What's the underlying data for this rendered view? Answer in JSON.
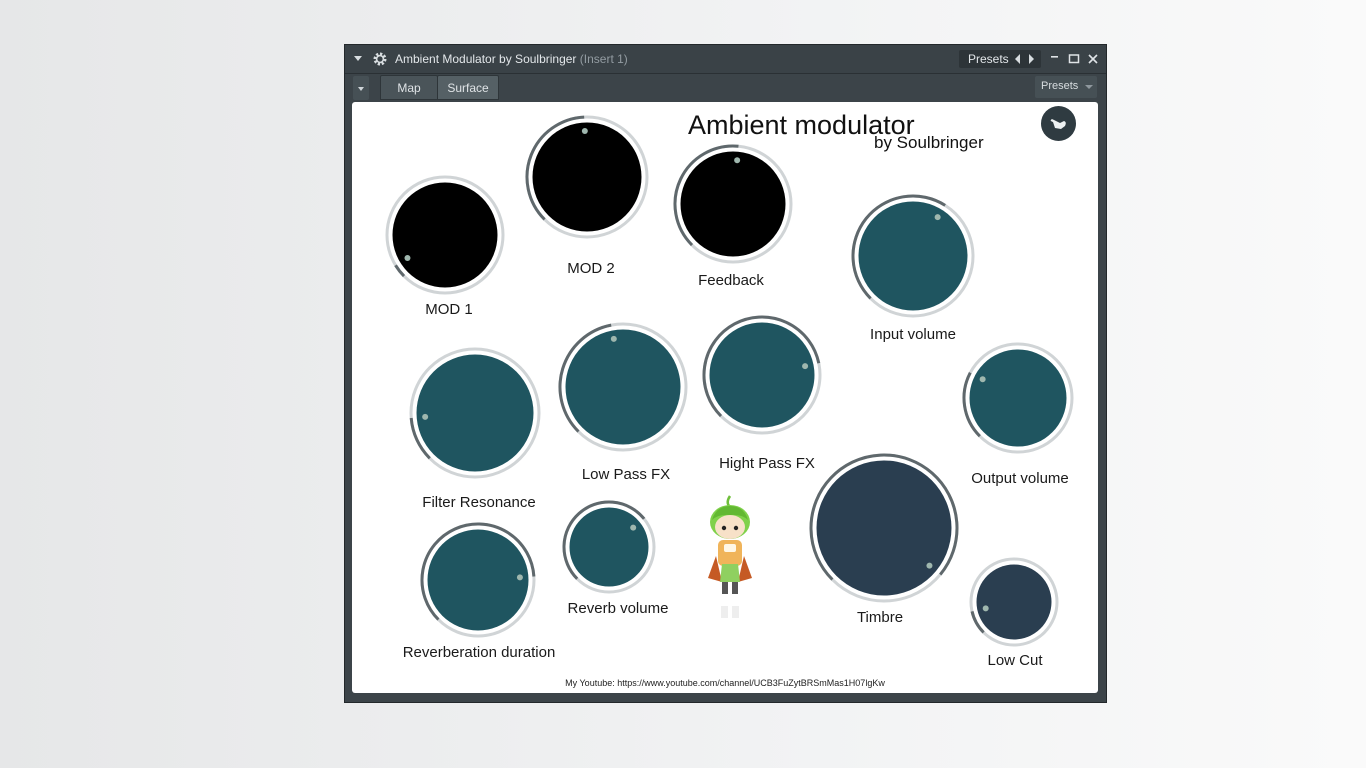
{
  "window": {
    "title": "Ambient Modulator by Soulbringer",
    "title_sub": "(Insert 1)",
    "presets_label": "Presets"
  },
  "toolbar": {
    "tabs": [
      {
        "label": "Map"
      },
      {
        "label": "Surface"
      }
    ],
    "presets_label": "Presets"
  },
  "plugin": {
    "title": "Ambient modulator",
    "subtitle": "by Soulbringer",
    "footer": "My Youtube: https://www.youtube.com/channel/UCB3FuZytBRSmMas1H07lgKw"
  },
  "colors": {
    "black_knob": "#000000",
    "teal_knob": "#1f5560",
    "navy_knob": "#2a3e50",
    "knob_ring": "#d0d4d6",
    "knob_arc": "#5f686c",
    "accent": "#3c4449"
  },
  "knobs": [
    {
      "id": "mod1",
      "label": "MOD 1",
      "color": "#000000",
      "value": 0.05
    },
    {
      "id": "mod2",
      "label": "MOD 2",
      "color": "#000000",
      "value": 0.49
    },
    {
      "id": "feedback",
      "label": "Feedback",
      "color": "#000000",
      "value": 0.52
    },
    {
      "id": "input-volume",
      "label": "Input volume",
      "color": "#1f5560",
      "value": 0.62
    },
    {
      "id": "filter-resonance",
      "label": "Filter Resonance",
      "color": "#1f5560",
      "value": 0.15
    },
    {
      "id": "low-pass-fx",
      "label": "Low Pass FX",
      "color": "#1f5560",
      "value": 0.46
    },
    {
      "id": "hight-pass-fx",
      "label": "Hight Pass FX",
      "color": "#1f5560",
      "value": 0.79
    },
    {
      "id": "output-volume",
      "label": "Output volume",
      "color": "#1f5560",
      "value": 0.27
    },
    {
      "id": "reverberation-duration",
      "label": "Reverberation duration",
      "color": "#1f5560",
      "value": 0.82
    },
    {
      "id": "reverb-volume",
      "label": "Reverb volume",
      "color": "#1f5560",
      "value": 0.69
    },
    {
      "id": "timbre",
      "label": "Timbre",
      "color": "#2a3e50",
      "value": 0.98
    },
    {
      "id": "low-cut",
      "label": "Low Cut",
      "color": "#2a3e50",
      "value": 0.12
    }
  ]
}
